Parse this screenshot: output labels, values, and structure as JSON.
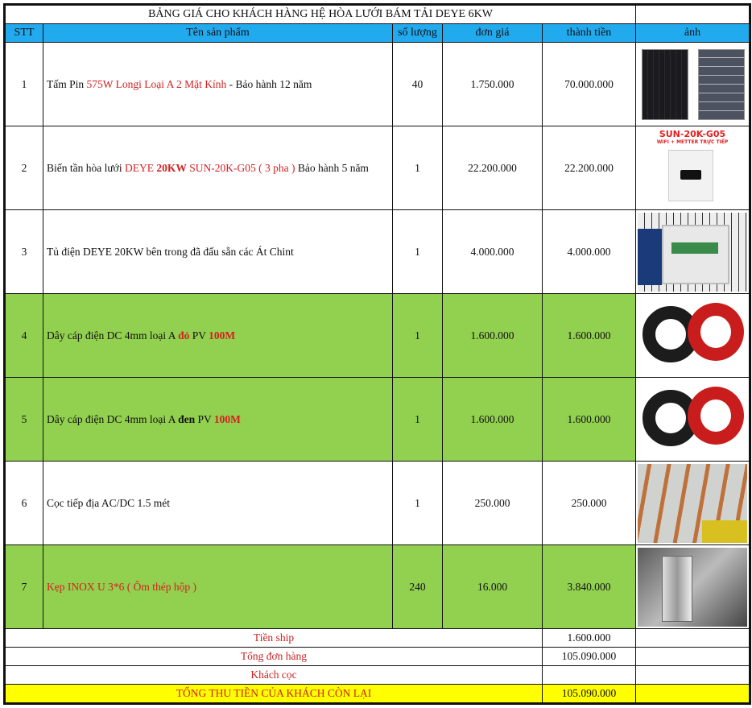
{
  "title": "BẢNG GIÁ CHO KHÁCH HÀNG HỆ HÒA LƯỚI BÁM TẢI DEYE 6KW",
  "headers": {
    "stt": "STT",
    "name": "Tên sản phẩm",
    "qty": "số lượng",
    "price": "đơn giá",
    "total": "thành tiền",
    "image": "ảnh"
  },
  "colors": {
    "header": "#22aaee",
    "green_row": "#92d050",
    "grand_total": "#ffff00",
    "accent_red": "#d42020"
  },
  "items": [
    {
      "stt": "1",
      "name": [
        {
          "t": "Tấm Pin "
        },
        {
          "t": "575W Longi Loại A 2 Mặt Kính",
          "c": "red"
        },
        {
          "t": " - Bảo hành 12 năm"
        }
      ],
      "qty": "40",
      "price": "1.750.000",
      "total": "70.000.000",
      "image": "solar-panels",
      "green": false
    },
    {
      "stt": "2",
      "name": [
        {
          "t": "Biến tần hòa lưới "
        },
        {
          "t": "DEYE ",
          "c": "red"
        },
        {
          "t": "20KW",
          "c": "red bold"
        },
        {
          "t": " SUN-20K-G05 ( 3 pha )",
          "c": "red"
        },
        {
          "t": "  Bảo hành 5 năm"
        }
      ],
      "qty": "1",
      "price": "22.200.000",
      "total": "22.200.000",
      "image": "inverter",
      "image_text": [
        "SUN-20K-G05",
        "WIFI + METTER TRỰC TIẾP"
      ],
      "green": false
    },
    {
      "stt": "3",
      "name": [
        {
          "t": "Tủ điện DEYE 20KW bên trong đã đấu sẵn các Át Chint"
        }
      ],
      "qty": "1",
      "price": "4.000.000",
      "total": "4.000.000",
      "image": "electrical-cabinet",
      "green": false
    },
    {
      "stt": "4",
      "name": [
        {
          "t": "Dây cáp điện DC 4mm loại A "
        },
        {
          "t": "đỏ",
          "c": "red bold"
        },
        {
          "t": " PV "
        },
        {
          "t": "100M",
          "c": "red bold"
        }
      ],
      "qty": "1",
      "price": "1.600.000",
      "total": "1.600.000",
      "image": "dc-cable",
      "green": true
    },
    {
      "stt": "5",
      "name": [
        {
          "t": "Dây cáp điện DC 4mm loại A "
        },
        {
          "t": "đen",
          "c": "bold"
        },
        {
          "t": " PV "
        },
        {
          "t": "100M",
          "c": "red bold"
        }
      ],
      "qty": "1",
      "price": "1.600.000",
      "total": "1.600.000",
      "image": "dc-cable",
      "green": true
    },
    {
      "stt": "6",
      "name": [
        {
          "t": "Cọc tiếp địa AC/DC 1.5 mét"
        }
      ],
      "qty": "1",
      "price": "250.000",
      "total": "250.000",
      "image": "ground-rods",
      "green": false
    },
    {
      "stt": "7",
      "name": [
        {
          "t": "Kẹp INOX U 3*6 ( Ôm thép hộp )",
          "c": "red"
        }
      ],
      "qty": "240",
      "price": "16.000",
      "total": "3.840.000",
      "image": "inox-clamp",
      "green": true
    }
  ],
  "footer": [
    {
      "label": "Tiền ship",
      "value": "1.600.000"
    },
    {
      "label": "Tổng đơn hàng",
      "value": "105.090.000"
    },
    {
      "label": "Khách cọc",
      "value": ""
    },
    {
      "label": "TỔNG THU TIỀN CỦA KHÁCH CÒN LẠI",
      "value": "105.090.000",
      "highlight": true
    }
  ]
}
